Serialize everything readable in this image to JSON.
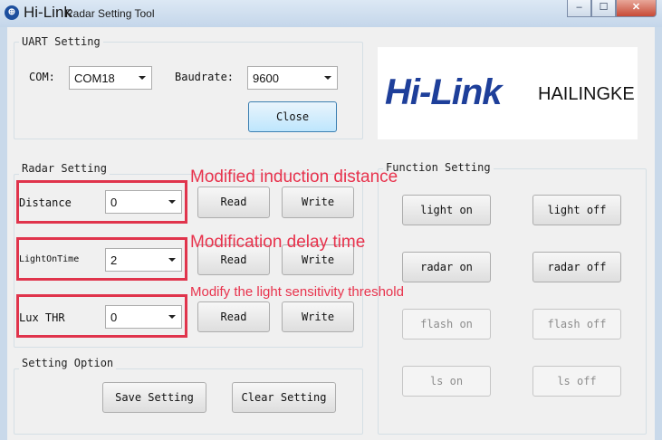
{
  "window": {
    "title_brand": "Hi-Link",
    "title_rest": "Radar Setting Tool",
    "min_glyph": "‒",
    "max_glyph": "☐",
    "close_glyph": "✕"
  },
  "uart": {
    "group_label": "UART Setting",
    "com_label": "COM:",
    "com_value": "COM18",
    "baud_label": "Baudrate:",
    "baud_value": "9600",
    "close_button": "Close"
  },
  "logo": {
    "main": "Hi-Link",
    "side": "HAILINGKE"
  },
  "radar": {
    "group_label": "Radar Setting",
    "rows": [
      {
        "label": "Distance",
        "value": "0",
        "read": "Read",
        "write": "Write"
      },
      {
        "label": "LightOnTime",
        "value": "2",
        "read": "Read",
        "write": "Write"
      },
      {
        "label": "Lux THR",
        "value": "0",
        "read": "Read",
        "write": "Write"
      }
    ]
  },
  "option": {
    "group_label": "Setting Option",
    "save": "Save Setting",
    "clear": "Clear Setting"
  },
  "function": {
    "group_label": "Function Setting",
    "light_on": "light on",
    "light_off": "light off",
    "radar_on": "radar on",
    "radar_off": "radar off",
    "flash_on": "flash on",
    "flash_off": "flash off",
    "ls_on": "ls on",
    "ls_off": "ls off"
  },
  "annotations": {
    "distance": "Modified induction distance",
    "delay": "Modification delay time",
    "lux": "Modify the light sensitivity threshold"
  },
  "colors": {
    "annotation_red": "#e0344c",
    "close_button_blue": "#bee6fd",
    "logo_blue": "#1e3f9a"
  }
}
